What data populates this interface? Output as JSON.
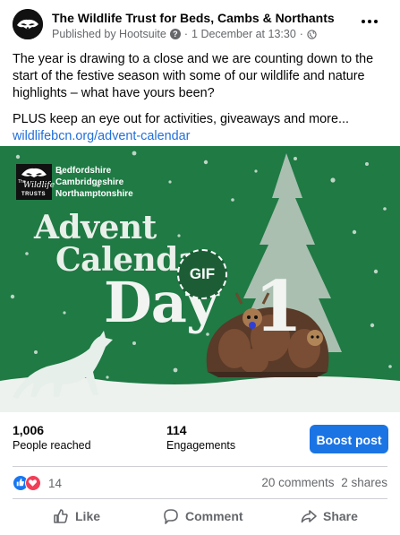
{
  "post": {
    "page_name": "The Wildlife Trust for Beds, Cambs & Northants",
    "published_by": "Published by Hootsuite",
    "date": "1 December at 13:30",
    "separator": "·",
    "text_1": "The year is drawing to a close and we are counting down to the start of the festive season with some of our wildlife and nature highlights – what have yours been?",
    "text_2": "PLUS keep an eye out for activities, giveaways and more...",
    "link": "wildlifebcn.org/advent-calendar"
  },
  "media": {
    "logo_trust_lines": [
      "The",
      "Wildlife",
      "TRUSTS"
    ],
    "org_lines": [
      "Bedfordshire",
      "Cambridgeshire",
      "Northamptonshire"
    ],
    "title_line_1": "Advent",
    "title_line_2": "Calendar",
    "day_label": "Day",
    "day_number": "1",
    "gif_badge": "GIF",
    "bg_color": "#1f7a44"
  },
  "stats": {
    "reached_value": "1,006",
    "reached_label": "People reached",
    "engagements_value": "114",
    "engagements_label": "Engagements",
    "boost_label": "Boost post"
  },
  "reactions": {
    "count": "14",
    "comments": "20 comments",
    "shares": "2 shares"
  },
  "actions": {
    "like": "Like",
    "comment": "Comment",
    "share": "Share"
  },
  "colors": {
    "accent": "#1b74e4",
    "link": "#216fdb",
    "muted": "#65676b"
  }
}
